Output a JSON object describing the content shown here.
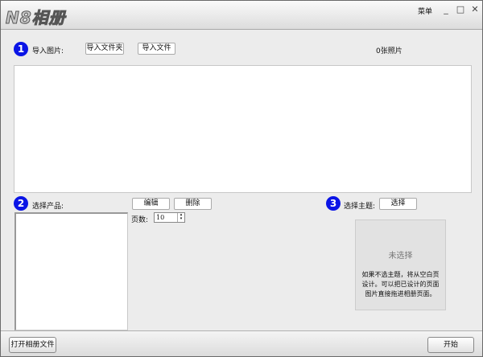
{
  "title": {
    "logo": "N8相册",
    "menu": "菜单",
    "minimize": "_",
    "maximize": "□",
    "close": "✕"
  },
  "step1": {
    "number": "1",
    "label": "导入图片:",
    "import_folder": "导入文件夹",
    "import_file": "导入文件",
    "photo_count": "0张照片"
  },
  "step2": {
    "number": "2",
    "label": "选择产品:",
    "edit": "编辑",
    "delete": "删除",
    "pages_label": "页数:",
    "pages_value": "10"
  },
  "step3": {
    "number": "3",
    "label": "选择主题:",
    "select": "选择",
    "preview_status": "未选择",
    "hint": "如果不选主题，将从空白页设计。可以把已设计的页面图片直接拖进相册页面。"
  },
  "bottom": {
    "open_album": "打开相册文件",
    "start": "开始"
  },
  "colors": {
    "step_circle": "#0a14e6"
  }
}
